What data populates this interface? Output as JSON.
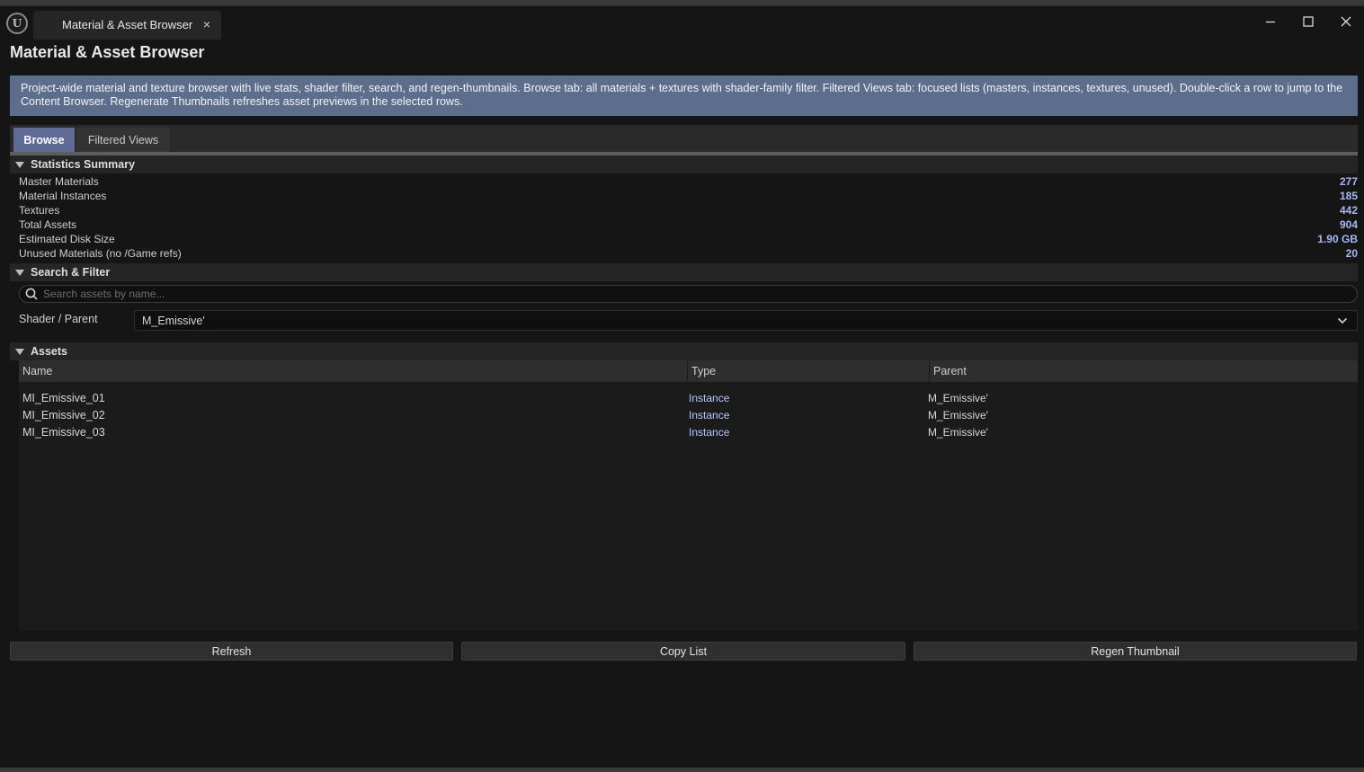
{
  "window": {
    "tab_title": "Material & Asset Browser",
    "tab_close": "×",
    "logo_glyph": "U"
  },
  "page": {
    "title": "Material & Asset Browser",
    "info": "Project-wide material and texture browser with live stats, shader filter, search, and regen-thumbnails. Browse tab: all materials + textures with shader-family filter. Filtered Views tab: focused lists (masters, instances, textures, unused). Double-click a row to jump to the Content Browser. Regenerate Thumbnails refreshes asset previews in the selected rows."
  },
  "tabs": [
    {
      "label": "Browse",
      "active": true
    },
    {
      "label": "Filtered Views",
      "active": false
    }
  ],
  "stats": {
    "header": "Statistics Summary",
    "rows": [
      {
        "label": "Master Materials",
        "value": "277"
      },
      {
        "label": "Material Instances",
        "value": "185"
      },
      {
        "label": "Textures",
        "value": "442"
      },
      {
        "label": "Total Assets",
        "value": "904"
      },
      {
        "label": "Estimated Disk Size",
        "value": "1.90 GB"
      },
      {
        "label": "Unused Materials (no /Game refs)",
        "value": "20"
      }
    ]
  },
  "filter": {
    "header": "Search & Filter",
    "search_placeholder": "Search assets by name...",
    "search_value": "",
    "shader_label": "Shader / Parent",
    "shader_value": "M_Emissive'"
  },
  "assets": {
    "header": "Assets",
    "columns": [
      "Name",
      "Type",
      "Parent"
    ],
    "rows": [
      {
        "name": "MI_Emissive_01",
        "type": "Instance",
        "parent": "M_Emissive'"
      },
      {
        "name": "MI_Emissive_02",
        "type": "Instance",
        "parent": "M_Emissive'"
      },
      {
        "name": "MI_Emissive_03",
        "type": "Instance",
        "parent": "M_Emissive'"
      }
    ]
  },
  "buttons": {
    "refresh": "Refresh",
    "copy": "Copy List",
    "regen": "Regen Thumbnail"
  },
  "colors": {
    "accent_tab": "#5f6b94",
    "info_banner": "#5c6e8c",
    "stat_value": "#a9b8f2",
    "type_text": "#b7c8ff"
  }
}
